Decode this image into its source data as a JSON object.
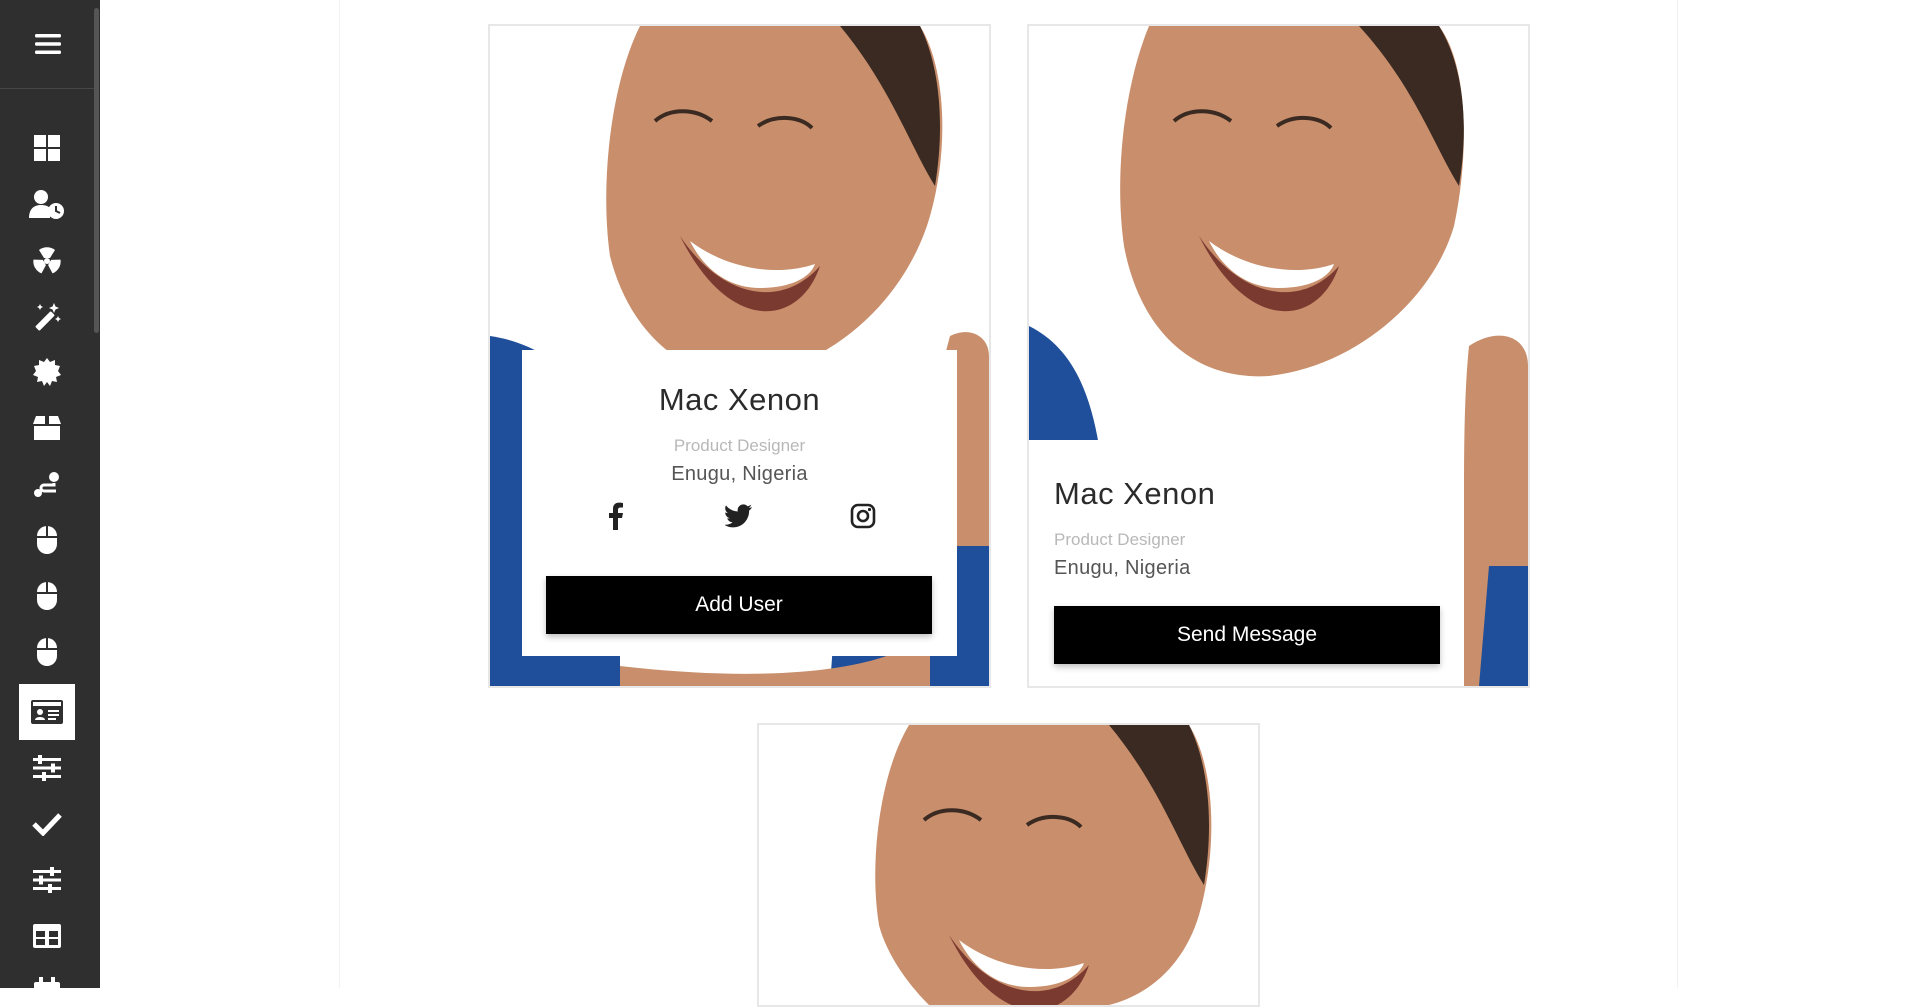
{
  "sidebar": {
    "menu_icon": "hamburger-menu-icon",
    "items": [
      {
        "icon": "dashboard-icon"
      },
      {
        "icon": "user-clock-icon"
      },
      {
        "icon": "radiation-icon"
      },
      {
        "icon": "magic-wand-icon"
      },
      {
        "icon": "badge-icon"
      },
      {
        "icon": "box-icon"
      },
      {
        "icon": "route-icon"
      },
      {
        "icon": "mouse-icon"
      },
      {
        "icon": "mouse-icon"
      },
      {
        "icon": "mouse-icon"
      },
      {
        "icon": "id-card-icon",
        "active": true
      },
      {
        "icon": "sliders-icon"
      },
      {
        "icon": "check-icon"
      },
      {
        "icon": "sliders-icon"
      },
      {
        "icon": "table-icon"
      },
      {
        "icon": "calendar-icon"
      }
    ]
  },
  "cards": [
    {
      "name": "Mac Xenon",
      "role": "Product Designer",
      "location": "Enugu, Nigeria",
      "social": [
        "facebook-icon",
        "twitter-icon",
        "instagram-icon"
      ],
      "button_label": "Add User"
    },
    {
      "name": "Mac Xenon",
      "role": "Product Designer",
      "location": "Enugu, Nigeria",
      "button_label": "Send Message"
    },
    {
      "photo_only": true
    }
  ],
  "colors": {
    "sidebar_bg": "#2f2f2f",
    "button_bg": "#000000",
    "button_text": "#ffffff",
    "photo_backdrop": "#1f4f9a"
  }
}
